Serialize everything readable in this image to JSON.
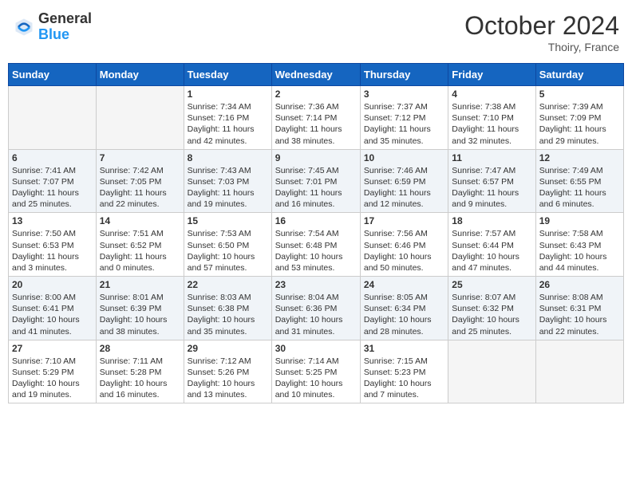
{
  "header": {
    "logo_line1": "General",
    "logo_line2": "Blue",
    "month": "October 2024",
    "location": "Thoiry, France"
  },
  "weekdays": [
    "Sunday",
    "Monday",
    "Tuesday",
    "Wednesday",
    "Thursday",
    "Friday",
    "Saturday"
  ],
  "weeks": [
    [
      {
        "day": "",
        "info": ""
      },
      {
        "day": "",
        "info": ""
      },
      {
        "day": "1",
        "info": "Sunrise: 7:34 AM\nSunset: 7:16 PM\nDaylight: 11 hours\nand 42 minutes."
      },
      {
        "day": "2",
        "info": "Sunrise: 7:36 AM\nSunset: 7:14 PM\nDaylight: 11 hours\nand 38 minutes."
      },
      {
        "day": "3",
        "info": "Sunrise: 7:37 AM\nSunset: 7:12 PM\nDaylight: 11 hours\nand 35 minutes."
      },
      {
        "day": "4",
        "info": "Sunrise: 7:38 AM\nSunset: 7:10 PM\nDaylight: 11 hours\nand 32 minutes."
      },
      {
        "day": "5",
        "info": "Sunrise: 7:39 AM\nSunset: 7:09 PM\nDaylight: 11 hours\nand 29 minutes."
      }
    ],
    [
      {
        "day": "6",
        "info": "Sunrise: 7:41 AM\nSunset: 7:07 PM\nDaylight: 11 hours\nand 25 minutes."
      },
      {
        "day": "7",
        "info": "Sunrise: 7:42 AM\nSunset: 7:05 PM\nDaylight: 11 hours\nand 22 minutes."
      },
      {
        "day": "8",
        "info": "Sunrise: 7:43 AM\nSunset: 7:03 PM\nDaylight: 11 hours\nand 19 minutes."
      },
      {
        "day": "9",
        "info": "Sunrise: 7:45 AM\nSunset: 7:01 PM\nDaylight: 11 hours\nand 16 minutes."
      },
      {
        "day": "10",
        "info": "Sunrise: 7:46 AM\nSunset: 6:59 PM\nDaylight: 11 hours\nand 12 minutes."
      },
      {
        "day": "11",
        "info": "Sunrise: 7:47 AM\nSunset: 6:57 PM\nDaylight: 11 hours\nand 9 minutes."
      },
      {
        "day": "12",
        "info": "Sunrise: 7:49 AM\nSunset: 6:55 PM\nDaylight: 11 hours\nand 6 minutes."
      }
    ],
    [
      {
        "day": "13",
        "info": "Sunrise: 7:50 AM\nSunset: 6:53 PM\nDaylight: 11 hours\nand 3 minutes."
      },
      {
        "day": "14",
        "info": "Sunrise: 7:51 AM\nSunset: 6:52 PM\nDaylight: 11 hours\nand 0 minutes."
      },
      {
        "day": "15",
        "info": "Sunrise: 7:53 AM\nSunset: 6:50 PM\nDaylight: 10 hours\nand 57 minutes."
      },
      {
        "day": "16",
        "info": "Sunrise: 7:54 AM\nSunset: 6:48 PM\nDaylight: 10 hours\nand 53 minutes."
      },
      {
        "day": "17",
        "info": "Sunrise: 7:56 AM\nSunset: 6:46 PM\nDaylight: 10 hours\nand 50 minutes."
      },
      {
        "day": "18",
        "info": "Sunrise: 7:57 AM\nSunset: 6:44 PM\nDaylight: 10 hours\nand 47 minutes."
      },
      {
        "day": "19",
        "info": "Sunrise: 7:58 AM\nSunset: 6:43 PM\nDaylight: 10 hours\nand 44 minutes."
      }
    ],
    [
      {
        "day": "20",
        "info": "Sunrise: 8:00 AM\nSunset: 6:41 PM\nDaylight: 10 hours\nand 41 minutes."
      },
      {
        "day": "21",
        "info": "Sunrise: 8:01 AM\nSunset: 6:39 PM\nDaylight: 10 hours\nand 38 minutes."
      },
      {
        "day": "22",
        "info": "Sunrise: 8:03 AM\nSunset: 6:38 PM\nDaylight: 10 hours\nand 35 minutes."
      },
      {
        "day": "23",
        "info": "Sunrise: 8:04 AM\nSunset: 6:36 PM\nDaylight: 10 hours\nand 31 minutes."
      },
      {
        "day": "24",
        "info": "Sunrise: 8:05 AM\nSunset: 6:34 PM\nDaylight: 10 hours\nand 28 minutes."
      },
      {
        "day": "25",
        "info": "Sunrise: 8:07 AM\nSunset: 6:32 PM\nDaylight: 10 hours\nand 25 minutes."
      },
      {
        "day": "26",
        "info": "Sunrise: 8:08 AM\nSunset: 6:31 PM\nDaylight: 10 hours\nand 22 minutes."
      }
    ],
    [
      {
        "day": "27",
        "info": "Sunrise: 7:10 AM\nSunset: 5:29 PM\nDaylight: 10 hours\nand 19 minutes."
      },
      {
        "day": "28",
        "info": "Sunrise: 7:11 AM\nSunset: 5:28 PM\nDaylight: 10 hours\nand 16 minutes."
      },
      {
        "day": "29",
        "info": "Sunrise: 7:12 AM\nSunset: 5:26 PM\nDaylight: 10 hours\nand 13 minutes."
      },
      {
        "day": "30",
        "info": "Sunrise: 7:14 AM\nSunset: 5:25 PM\nDaylight: 10 hours\nand 10 minutes."
      },
      {
        "day": "31",
        "info": "Sunrise: 7:15 AM\nSunset: 5:23 PM\nDaylight: 10 hours\nand 7 minutes."
      },
      {
        "day": "",
        "info": ""
      },
      {
        "day": "",
        "info": ""
      }
    ]
  ]
}
